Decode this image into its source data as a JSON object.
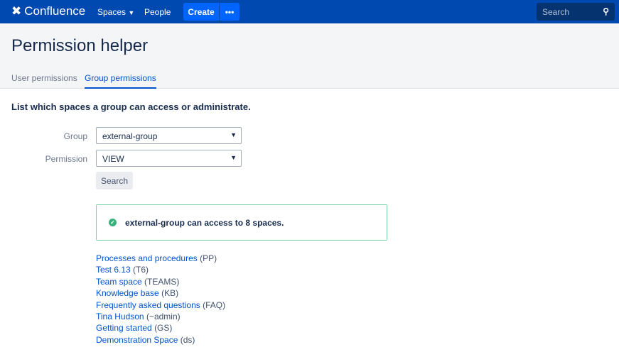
{
  "header": {
    "logo": "Confluence",
    "spaces": "Spaces",
    "people": "People",
    "create": "Create",
    "more": "•••",
    "search_placeholder": "Search"
  },
  "page": {
    "title": "Permission helper",
    "tabs": [
      {
        "label": "User permissions"
      },
      {
        "label": "Group permissions"
      }
    ],
    "intro": "List which spaces a group can access or administrate."
  },
  "form": {
    "group_label": "Group",
    "group_value": "external-group",
    "permission_label": "Permission",
    "permission_value": "VIEW",
    "search_button": "Search"
  },
  "result": {
    "message": "external-group can access to 8 spaces."
  },
  "spaces": [
    {
      "name": "Processes and procedures",
      "key": "(PP)"
    },
    {
      "name": "Test 6.13",
      "key": "(T6)"
    },
    {
      "name": "Team space",
      "key": "(TEAMS)"
    },
    {
      "name": "Knowledge base",
      "key": "(KB)"
    },
    {
      "name": "Frequently asked questions",
      "key": "(FAQ)"
    },
    {
      "name": "Tina Hudson",
      "key": "(~admin)"
    },
    {
      "name": "Getting started",
      "key": "(GS)"
    },
    {
      "name": "Demonstration Space",
      "key": "(ds)"
    }
  ],
  "colors": {
    "header": "#0049b0",
    "accent": "#0052cc",
    "success": "#36b37e"
  }
}
